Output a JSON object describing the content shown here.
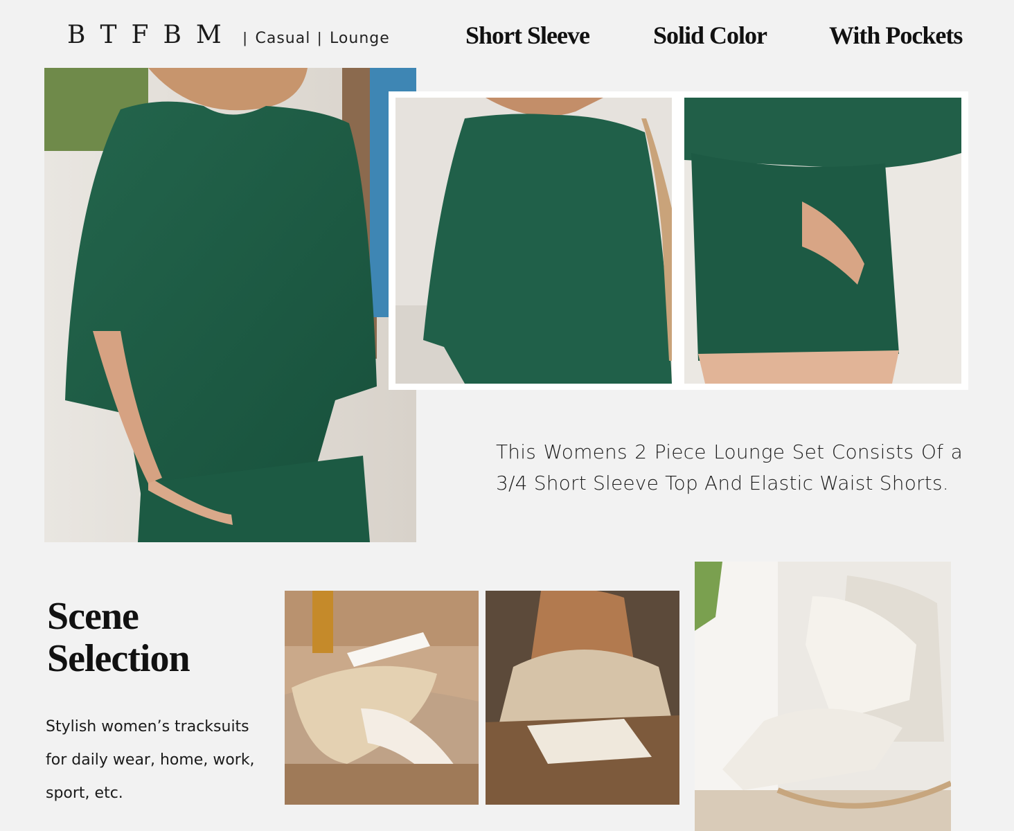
{
  "brand": {
    "name": "BTFBM",
    "sep": "|",
    "tag1": "Casual",
    "tag2": "Lounge"
  },
  "features": [
    "Short Sleeve",
    "Solid Color",
    "With Pockets"
  ],
  "description": "This Womens 2 Piece Lounge Set Consists Of a 3/4 Short Sleeve Top And Elastic Waist Shorts.",
  "scene": {
    "title_line1": "Scene",
    "title_line2": "Selection",
    "text": "Stylish women’s tracksuits for daily wear, home, work, sport, etc."
  },
  "colors": {
    "background": "#f2f2f2",
    "garment_green": "#1f5c45",
    "text": "#111111"
  },
  "photos": [
    "model-main-photo",
    "top-detail-photo",
    "shorts-pocket-photo",
    "sofa-reading-photo",
    "writing-desk-photo",
    "rocking-chair-photo"
  ]
}
